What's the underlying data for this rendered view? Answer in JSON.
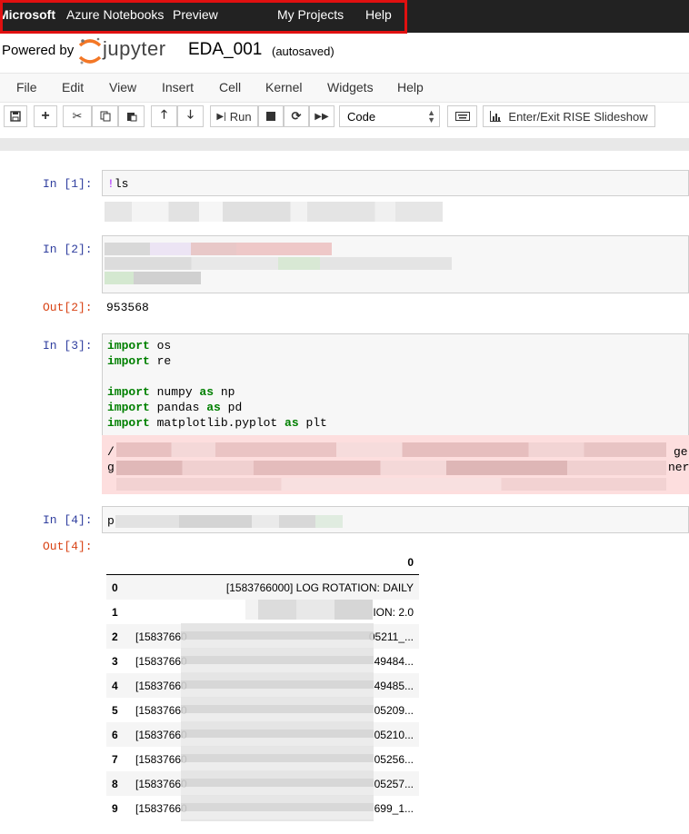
{
  "topbar": {
    "brand_bold": "Microsoft",
    "brand_rest": "Azure Notebooks",
    "preview": "Preview",
    "my_projects": "My Projects",
    "help": "Help"
  },
  "header": {
    "powered_by": "Powered by",
    "jupyter": "jupyter",
    "notebook_name": "EDA_001",
    "autosave": "(autosaved)"
  },
  "menu": [
    "File",
    "Edit",
    "View",
    "Insert",
    "Cell",
    "Kernel",
    "Widgets",
    "Help"
  ],
  "toolbar": {
    "run_label": "Run",
    "cell_type": "Code",
    "rise_label": "Enter/Exit RISE Slideshow"
  },
  "cells": {
    "c1": {
      "prompt": "In [1]:",
      "code_magic": "!",
      "code_rest": "ls"
    },
    "c2": {
      "prompt": "In [2]:",
      "out_prompt": "Out[2]:",
      "output": "953568"
    },
    "c3": {
      "prompt": "In [3]:",
      "lines": [
        {
          "kw": "import",
          "rest": " os"
        },
        {
          "kw": "import",
          "rest": " re"
        },
        {
          "kw": "",
          "rest": ""
        },
        {
          "kw": "import",
          "rest": " numpy ",
          "kw2": "as",
          "rest2": " np"
        },
        {
          "kw": "import",
          "rest": " pandas ",
          "kw2": "as",
          "rest2": " pd"
        },
        {
          "kw": "import",
          "rest": " matplotlib.pyplot ",
          "kw2": "as",
          "rest2": " plt"
        }
      ],
      "stderr_start_1": "/",
      "stderr_start_2": "g",
      "stderr_end_1": "ge",
      "stderr_end_2": "ner"
    },
    "c4": {
      "prompt": "In [4]:",
      "code_start": "p",
      "out_prompt": "Out[4]:"
    }
  },
  "dataframe": {
    "column": "0",
    "rows": [
      {
        "idx": "0",
        "left": "",
        "right": "[1583766000] LOG ROTATION: DAILY"
      },
      {
        "idx": "1",
        "left": "",
        "right": "ION: 2.0"
      },
      {
        "idx": "2",
        "left": "[15837660",
        "right": "05211_..."
      },
      {
        "idx": "3",
        "left": "[15837660",
        "right": "49484..."
      },
      {
        "idx": "4",
        "left": "[15837660",
        "right": "49485..."
      },
      {
        "idx": "5",
        "left": "[15837660",
        "right": "05209..."
      },
      {
        "idx": "6",
        "left": "[15837660",
        "right": "05210..."
      },
      {
        "idx": "7",
        "left": "[15837660",
        "right": "05256..."
      },
      {
        "idx": "8",
        "left": "[15837660",
        "right": "05257..."
      },
      {
        "idx": "9",
        "left": "[15837660",
        "right": "699_1..."
      }
    ]
  }
}
